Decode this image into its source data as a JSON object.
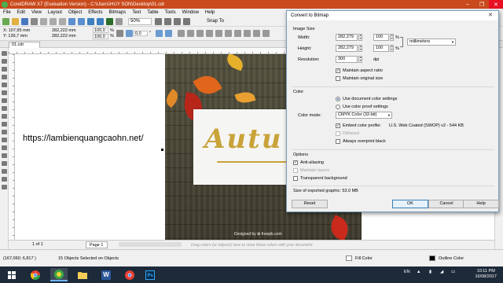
{
  "window": {
    "title": "CorelDRAW X7 (Evaluation Version) - C:\\Users\\HUY SON\\Desktop\\01.cdr",
    "controls": {
      "minimize": "–",
      "maximize": "❐",
      "close": "✕"
    }
  },
  "menu": [
    "File",
    "Edit",
    "View",
    "Layout",
    "Object",
    "Effects",
    "Bitmaps",
    "Text",
    "Table",
    "Tools",
    "Window",
    "Help"
  ],
  "toolbar": {
    "zoom": "50%",
    "snap": "Snap To"
  },
  "property_bar": {
    "x": "X: 107,95 mm",
    "y": "Y: 139,7 mm",
    "w": "282,222 mm",
    "h": "282,222 mm",
    "scale_w": "100,0",
    "scale_h": "100,0",
    "pct": "%",
    "angle": "0,0",
    "angle_unit": "°"
  },
  "document_tab": "01.cdr",
  "canvas": {
    "url_text": "https://lambienquangcaohn.net/",
    "banner_word": "Autu",
    "credit": "Designed by ✿ freepik.com"
  },
  "page_nav": {
    "counter": "1 of 1",
    "page_tab": "Page 1",
    "hint": "Drag colors (or objects) here to store these colors with your document"
  },
  "status": {
    "coords": "(167,060; 6,817 )",
    "selection": "15 Objects Selected on Objects",
    "fill": "Fill Color",
    "outline": "Outline Color"
  },
  "taskbar": {
    "lang": "EN",
    "time": "10:11 PM",
    "date": "16/08/2017",
    "apps": [
      "chrome-icon",
      "coreldraw-icon",
      "word-icon",
      "folder-icon",
      "photoshop-icon"
    ],
    "word_label": "W",
    "ps_label": "Ps"
  },
  "dialog": {
    "title": "Convert to Bitmap",
    "close": "✕",
    "image_size": {
      "heading": "Image Size",
      "width_label": "Width:",
      "width_value": "282,279",
      "width_pct": "100",
      "height_label": "Height:",
      "height_value": "282,279",
      "height_pct": "100",
      "pct_sign": "%",
      "units": "millimeters",
      "resolution_label": "Resolution:",
      "resolution_value": "300",
      "resolution_unit": "dpi",
      "maintain_aspect": "Maintain aspect ratio",
      "maintain_original": "Maintain original size"
    },
    "color": {
      "heading": "Color",
      "use_doc": "Use document color settings",
      "use_proof": "Use color proof settings",
      "mode_label": "Color mode:",
      "mode_value": "CMYK Color (32-bit)",
      "embed": "Embed color profile:",
      "profile": "U.S. Web Coated (SWOP) v2 - 544 KB",
      "dithered": "Dithered",
      "overprint": "Always overprint black"
    },
    "options": {
      "heading": "Options",
      "anti_alias": "Anti-aliasing",
      "maintain_layers": "Maintain layers",
      "transparent_bg": "Transparent background"
    },
    "size_info": "Size of exported graphic: 53.0 MB",
    "buttons": {
      "reset": "Reset",
      "ok": "OK",
      "cancel": "Cancel",
      "help": "Help"
    }
  },
  "colors": {
    "titlebar": "#c94a1c",
    "taskbar": "#1d2a3a",
    "accent": "#1e5bbf",
    "gold": "#c9a33a"
  }
}
